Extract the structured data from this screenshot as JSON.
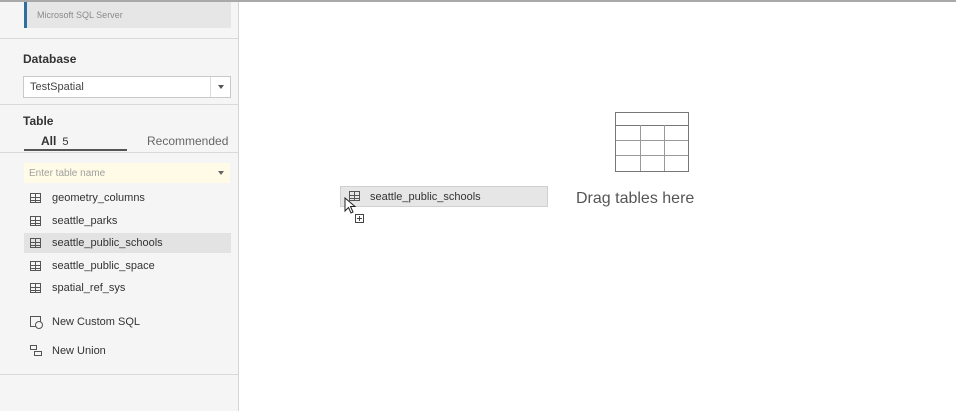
{
  "connection": {
    "subtitle": "Microsoft SQL Server"
  },
  "database": {
    "label": "Database",
    "selected": "TestSpatial"
  },
  "table_section": {
    "label": "Table",
    "tabs": {
      "all_label": "All",
      "all_count": "5",
      "recommended_label": "Recommended"
    },
    "search_placeholder": "Enter table name",
    "tables": [
      {
        "label": "geometry_columns"
      },
      {
        "label": "seattle_parks"
      },
      {
        "label": "seattle_public_schools",
        "selected": true
      },
      {
        "label": "seattle_public_space"
      },
      {
        "label": "spatial_ref_sys"
      }
    ],
    "actions": [
      {
        "label": "New Custom SQL",
        "icon": "custom-sql-icon"
      },
      {
        "label": "New Union",
        "icon": "union-icon"
      }
    ]
  },
  "canvas": {
    "dragging_table": "seattle_public_schools",
    "drop_hint": "Drag tables here"
  },
  "colors": {
    "sidebar_bg": "#f5f5f5",
    "selected_row": "#e3e3e3",
    "search_bg": "#fffbe6",
    "accent_bar": "#2f6f9f"
  }
}
